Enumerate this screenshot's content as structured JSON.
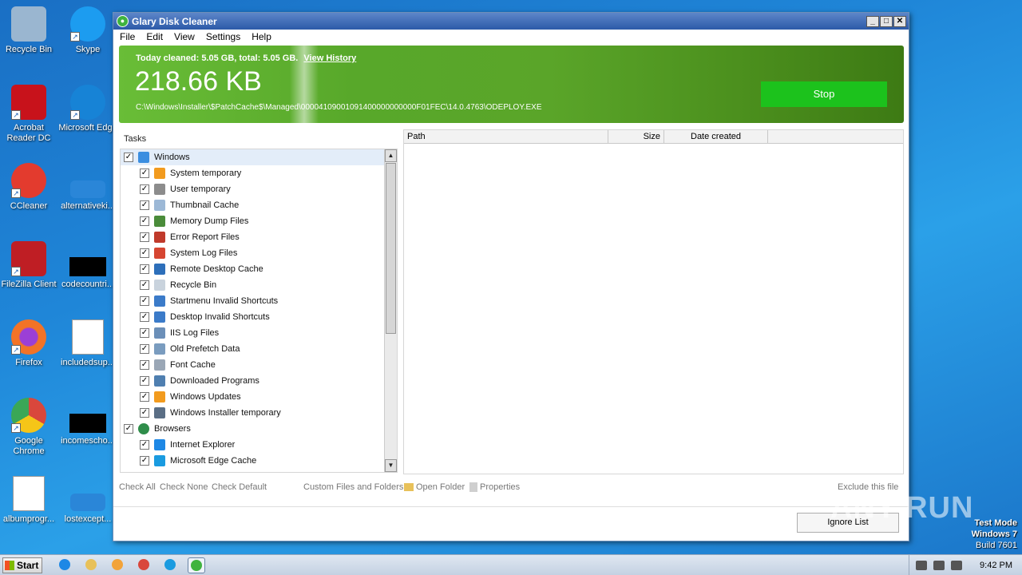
{
  "desktop": {
    "icons": [
      {
        "label": "Recycle Bin",
        "color": "#9ab6d0"
      },
      {
        "label": "Skype",
        "color": "#1c9cf0"
      },
      {
        "label": "Acrobat Reader DC",
        "color": "#c8121b"
      },
      {
        "label": "Microsoft Edge",
        "color": "#1783d6"
      },
      {
        "label": "CCleaner",
        "color": "#e33b2e"
      },
      {
        "label": "alternativeki...",
        "color": "#2a86d8"
      },
      {
        "label": "FileZilla Client",
        "color": "#bf1e24"
      },
      {
        "label": "codecountri...",
        "color": "#000000"
      },
      {
        "label": "Firefox",
        "color": "#f27327"
      },
      {
        "label": "includedsup...",
        "color": "#ffffff"
      },
      {
        "label": "Google Chrome",
        "color": "#e6e6e6"
      },
      {
        "label": "incomescho...",
        "color": "#000000"
      },
      {
        "label": "albumprogr...",
        "color": "#ffffff"
      },
      {
        "label": "lostexcept...",
        "color": "#2a86d8"
      }
    ]
  },
  "window": {
    "title": "Glary Disk Cleaner",
    "controls": [
      "_",
      "□",
      "✕"
    ],
    "menu": [
      "File",
      "Edit",
      "View",
      "Settings",
      "Help"
    ]
  },
  "banner": {
    "today": "Today cleaned: 5.05 GB, total: 5.05 GB.",
    "history_link": "View History",
    "size": "218.66 KB",
    "current_path": "C:\\Windows\\Installer\\$PatchCache$\\Managed\\00004109001091400000000000F01FEC\\14.0.4763\\ODEPLOY.EXE",
    "stop_label": "Stop"
  },
  "tasks": {
    "label": "Tasks",
    "items": [
      {
        "label": "Windows",
        "level": 0,
        "icon": "windows-icon",
        "color": "#3b8ee0",
        "selected": true
      },
      {
        "label": "System temporary",
        "level": 1,
        "icon": "windows-flag-icon",
        "color": "#f29b1e"
      },
      {
        "label": "User temporary",
        "level": 1,
        "icon": "user-temp-icon",
        "color": "#8c8c8c"
      },
      {
        "label": "Thumbnail Cache",
        "level": 1,
        "icon": "thumbnail-icon",
        "color": "#9cb8d6"
      },
      {
        "label": "Memory Dump Files",
        "level": 1,
        "icon": "memory-icon",
        "color": "#4a8c3a"
      },
      {
        "label": "Error Report Files",
        "level": 1,
        "icon": "error-report-icon",
        "color": "#c03a2b"
      },
      {
        "label": "System Log Files",
        "level": 1,
        "icon": "log-icon",
        "color": "#d64531"
      },
      {
        "label": "Remote Desktop Cache",
        "level": 1,
        "icon": "remote-desktop-icon",
        "color": "#2d6fba"
      },
      {
        "label": "Recycle Bin",
        "level": 1,
        "icon": "recycle-bin-icon",
        "color": "#c9d3dd"
      },
      {
        "label": "Startmenu Invalid Shortcuts",
        "level": 1,
        "icon": "shortcut-icon",
        "color": "#3b7bc9"
      },
      {
        "label": "Desktop Invalid Shortcuts",
        "level": 1,
        "icon": "desktop-shortcut-icon",
        "color": "#3b7bc9"
      },
      {
        "label": "IIS Log Files",
        "level": 1,
        "icon": "iis-icon",
        "color": "#6b8fb8"
      },
      {
        "label": "Old Prefetch Data",
        "level": 1,
        "icon": "prefetch-icon",
        "color": "#7a9cbf"
      },
      {
        "label": "Font Cache",
        "level": 1,
        "icon": "font-icon",
        "color": "#9aa7b6"
      },
      {
        "label": "Downloaded Programs",
        "level": 1,
        "icon": "download-icon",
        "color": "#4f7fb0"
      },
      {
        "label": "Windows Updates",
        "level": 1,
        "icon": "windows-update-icon",
        "color": "#f29b1e"
      },
      {
        "label": "Windows Installer temporary",
        "level": 1,
        "icon": "installer-icon",
        "color": "#5a6e85"
      },
      {
        "label": "Browsers",
        "level": 0,
        "icon": "globe-icon",
        "color": "#2f8d4a"
      },
      {
        "label": "Internet Explorer",
        "level": 1,
        "icon": "ie-icon",
        "color": "#1e88e5"
      },
      {
        "label": "Microsoft Edge Cache",
        "level": 1,
        "icon": "edge-icon",
        "color": "#1a9be0"
      }
    ]
  },
  "file_list": {
    "columns": [
      "Path",
      "Size",
      "Date created"
    ]
  },
  "actions": {
    "check_all": "Check All",
    "check_none": "Check None",
    "check_default": "Check Default",
    "custom": "Custom Files and Folders",
    "open_folder": "Open Folder",
    "properties": "Properties",
    "exclude": "Exclude this file",
    "ignore_list": "Ignore List"
  },
  "watermark": "ANY RUN",
  "os": {
    "line1": "Test Mode",
    "line2": "Windows 7",
    "line3": "Build 7601"
  },
  "taskbar": {
    "start": "Start",
    "apps": [
      {
        "name": "ie-icon",
        "color": "#1e88e5"
      },
      {
        "name": "explorer-icon",
        "color": "#e8c15a"
      },
      {
        "name": "media-player-icon",
        "color": "#f2a33a"
      },
      {
        "name": "chrome-icon",
        "color": "#d9473c"
      },
      {
        "name": "edge-icon",
        "color": "#1a9be0"
      },
      {
        "name": "glary-icon",
        "color": "#3fb33f"
      }
    ],
    "time": "9:42 PM"
  }
}
